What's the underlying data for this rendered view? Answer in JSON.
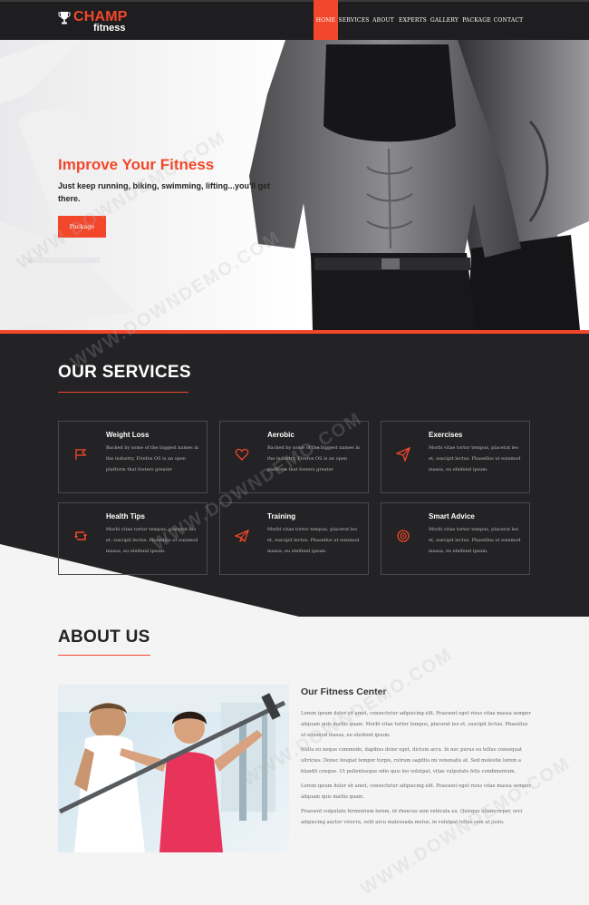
{
  "brand": {
    "name_top": "CHAMP",
    "name_bottom": "fitness"
  },
  "nav": {
    "items": [
      {
        "label": "HOME",
        "active": true
      },
      {
        "label": "SERVICES"
      },
      {
        "label": "ABOUT"
      },
      {
        "label": "EXPERTS"
      },
      {
        "label": "GALLERY"
      },
      {
        "label": "PACKAGE"
      },
      {
        "label": "CONTACT"
      }
    ]
  },
  "hero": {
    "title": "Improve Your Fitness",
    "text": "Just keep running, biking, swimming, lifting...you'll get there.",
    "button": "Package"
  },
  "services": {
    "title": "OUR SERVICES",
    "cards": [
      {
        "title": "Weight Loss",
        "icon": "flag-icon",
        "text": "Backed by some of the biggest names in the industry, Firefox OS is an open platform that fosters greater"
      },
      {
        "title": "Aerobic",
        "icon": "heart-icon",
        "text": "Backed by some of the biggest names in the industry, Firefox OS is an open platform that fosters greater"
      },
      {
        "title": "Exercises",
        "icon": "paper-plane-icon",
        "text": "Morbi vitae tortor tempus, placerat leo et, suscipit lectus. Phasellus ut euismod massa, eu eleifend ipsum."
      },
      {
        "title": "Health Tips",
        "icon": "retweet-icon",
        "text": "Morbi vitae tortor tempus, placerat leo et, suscipit lectus. Phasellus ut euismod massa, eu eleifend ipsum."
      },
      {
        "title": "Training",
        "icon": "send-icon",
        "text": "Morbi vitae tortor tempus, placerat leo et, suscipit lectus. Phasellus ut euismod massa, eu eleifend ipsum."
      },
      {
        "title": "Smart Advice",
        "icon": "target-icon",
        "text": "Morbi vitae tortor tempus, placerat leo et, suscipit lectus. Phasellus ut euismod massa, eu eleifend ipsum."
      }
    ]
  },
  "about": {
    "title": "ABOUT US",
    "heading": "Our Fitness Center",
    "paragraphs": [
      "Lorem ipsum dolor sit amet, consectetur adipiscing elit. Praesent eget risus vitae massa semper aliquam quis mattis quam. Morbi vitae tortor tempus, placerat leo et, suscipit lectus. Phasellus ut euismod massa, eu eleifend ipsum.",
      "Nulla eu neque commodo, dapibus dolor eget, dictum arcu. In nec purus eu tellus consequat ultricies. Donec feugiat tempor turpis, rutrum sagittis mi venenatis at. Sed molestie lorem a blandit congue. Ut pellentesque odio quis leo volutpat, vitae vulputate felis condimentum.",
      "Lorem ipsum dolor sit amet, consectetur adipiscing elit. Praesent eget risus vitae massa semper aliquam quis mattis quam.",
      "Praesent vulputate fermentum lorem, id rhoncus sem vehicula eu. Quisque ullamcorper, orci adipiscing auctor viverra, velit arcu malesuada metus, in volutpat tellus sem at justo."
    ]
  },
  "watermark": "WWW.DOWNDEMO.COM",
  "colors": {
    "accent": "#f2472b",
    "dark": "#232224",
    "nav": "#1e1d1f",
    "light": "#f4f4f5"
  }
}
